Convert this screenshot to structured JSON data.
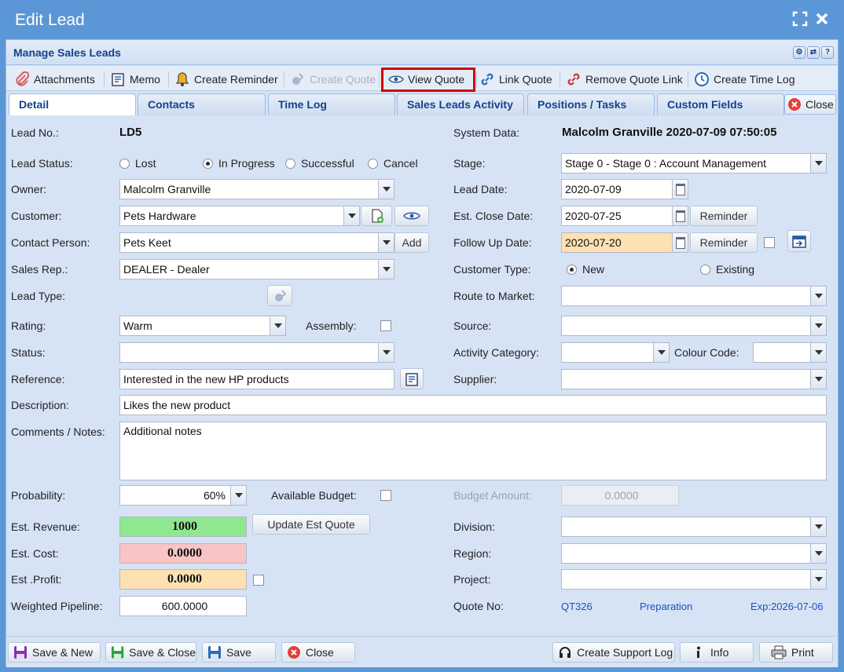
{
  "window": {
    "title": "Edit Lead"
  },
  "panel": {
    "title": "Manage Sales Leads"
  },
  "toolbar": {
    "attachments": "Attachments",
    "memo": "Memo",
    "create_reminder": "Create Reminder",
    "create_quote": "Create Quote",
    "view_quote": "View Quote",
    "link_quote": "Link Quote",
    "remove_quote_link": "Remove Quote Link",
    "create_time_log": "Create Time Log"
  },
  "tabs": {
    "detail": "Detail",
    "contacts": "Contacts",
    "time_log": "Time Log",
    "activity": "Sales Leads Activity",
    "positions": "Positions / Tasks",
    "custom": "Custom Fields",
    "close": "Close"
  },
  "form": {
    "lead_no_label": "Lead No.:",
    "lead_no": "LD5",
    "system_data_label": "System Data:",
    "system_data": "Malcolm Granville 2020-07-09 07:50:05",
    "lead_status_label": "Lead Status:",
    "status_lost": "Lost",
    "status_in_progress": "In Progress",
    "status_successful": "Successful",
    "status_cancel": "Cancel",
    "stage_label": "Stage:",
    "stage": "Stage 0 - Stage 0 : Account Management",
    "owner_label": "Owner:",
    "owner": "Malcolm Granville",
    "lead_date_label": "Lead Date:",
    "lead_date": "2020-07-09",
    "customer_label": "Customer:",
    "customer": "Pets Hardware",
    "est_close_label": "Est. Close Date:",
    "est_close": "2020-07-25",
    "reminder": "Reminder",
    "contact_label": "Contact Person:",
    "contact": "Pets Keet",
    "add": "Add",
    "follow_up_label": "Follow Up Date:",
    "follow_up": "2020-07-20",
    "sales_rep_label": "Sales Rep.:",
    "sales_rep": "DEALER - Dealer",
    "customer_type_label": "Customer Type:",
    "type_new": "New",
    "type_existing": "Existing",
    "lead_type_label": "Lead Type:",
    "route_label": "Route to Market:",
    "rating_label": "Rating:",
    "rating": "Warm",
    "assembly_label": "Assembly:",
    "source_label": "Source:",
    "status_label": "Status:",
    "activity_cat_label": "Activity Category:",
    "colour_code_label": "Colour Code:",
    "reference_label": "Reference:",
    "reference": "Interested in the new HP products",
    "supplier_label": "Supplier:",
    "description_label": "Description:",
    "description": "Likes the new product",
    "comments_label": "Comments / Notes:",
    "comments": "Additional notes",
    "probability_label": "Probability:",
    "probability": "60%",
    "available_budget_label": "Available Budget:",
    "budget_amount_label": "Budget Amount:",
    "budget_amount": "0.0000",
    "est_revenue_label": "Est. Revenue:",
    "est_revenue": "1000",
    "update_est_quote": "Update Est Quote",
    "division_label": "Division:",
    "est_cost_label": "Est. Cost:",
    "est_cost": "0.0000",
    "region_label": "Region:",
    "est_profit_label": "Est .Profit:",
    "est_profit": "0.0000",
    "project_label": "Project:",
    "weighted_label": "Weighted Pipeline:",
    "weighted": "600.0000",
    "quote_no_label": "Quote No:",
    "quote_no": "QT326",
    "quote_status": "Preparation",
    "quote_exp": "Exp:2026-07-06"
  },
  "bottom": {
    "save_new": "Save & New",
    "save_close": "Save & Close",
    "save": "Save",
    "close": "Close",
    "create_support_log": "Create Support Log",
    "info": "Info",
    "print": "Print"
  },
  "colors": {
    "revenue_bg": "#8fe78f",
    "cost_bg": "#f8c4c4",
    "profit_bg": "#fde1b2",
    "follow_up_bg": "#fde1b2",
    "highlight": "#d40000"
  }
}
